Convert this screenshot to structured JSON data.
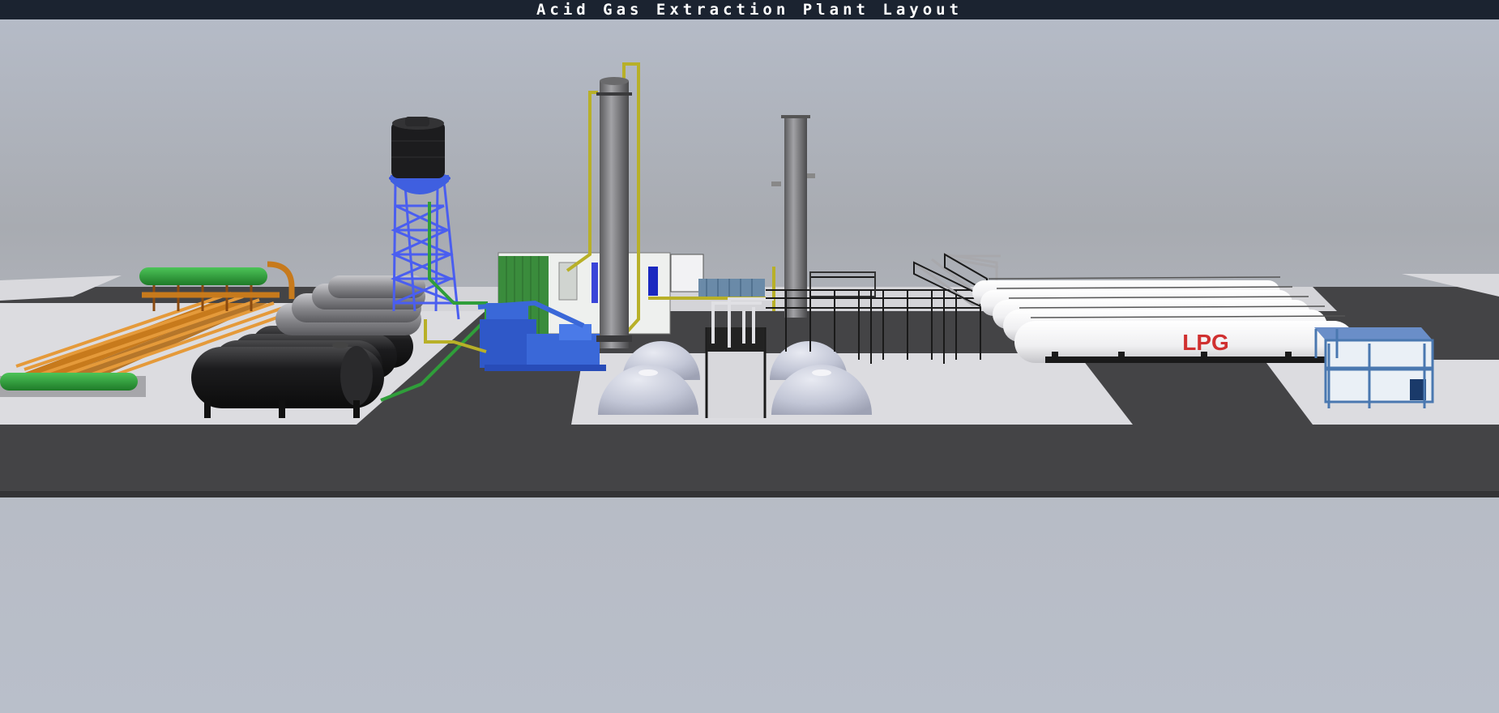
{
  "window": {
    "title": "Acid Gas Extraction Plant Layout"
  },
  "scene": {
    "tank_label": "LPG",
    "colors": {
      "background_top": "#b4bac6",
      "background_mid": "#a7aaaf",
      "background_bottom": "#b9bfca",
      "asphalt": "#444446",
      "concrete": "#dcdce0",
      "pipe_orange": "#c77a1c",
      "pipe_green": "#2f9e3a",
      "pipe_yellow": "#b8b028",
      "steel_blue": "#3f5fe0",
      "container_blue": "#4a78b0",
      "lpg_red": "#d03030"
    }
  }
}
